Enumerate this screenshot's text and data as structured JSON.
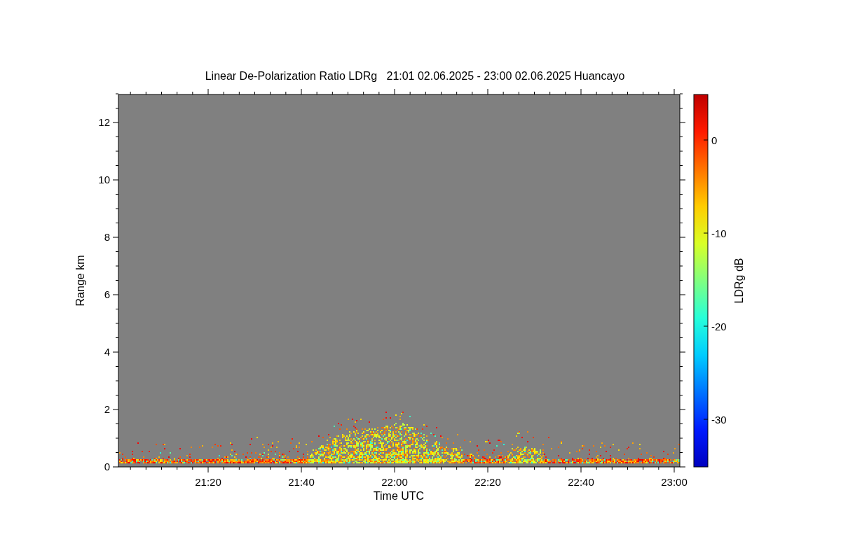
{
  "title": "Linear De-Polarization Ratio LDRg   21:01 02.06.2025 - 23:00 02.06.2025 Huancayo",
  "ylabel": "Range km",
  "yticks": [
    "12",
    "10",
    "8",
    "6",
    "4",
    "2",
    "0"
  ],
  "xlabel": "Time UTC",
  "xticks": [
    "21:20",
    "21:40",
    "22:00",
    "22:20",
    "22:40",
    "23:00"
  ],
  "colorbar": {
    "label": "LDRg dB",
    "ticks": [
      "0",
      "-10",
      "-20",
      "-30"
    ]
  }
}
